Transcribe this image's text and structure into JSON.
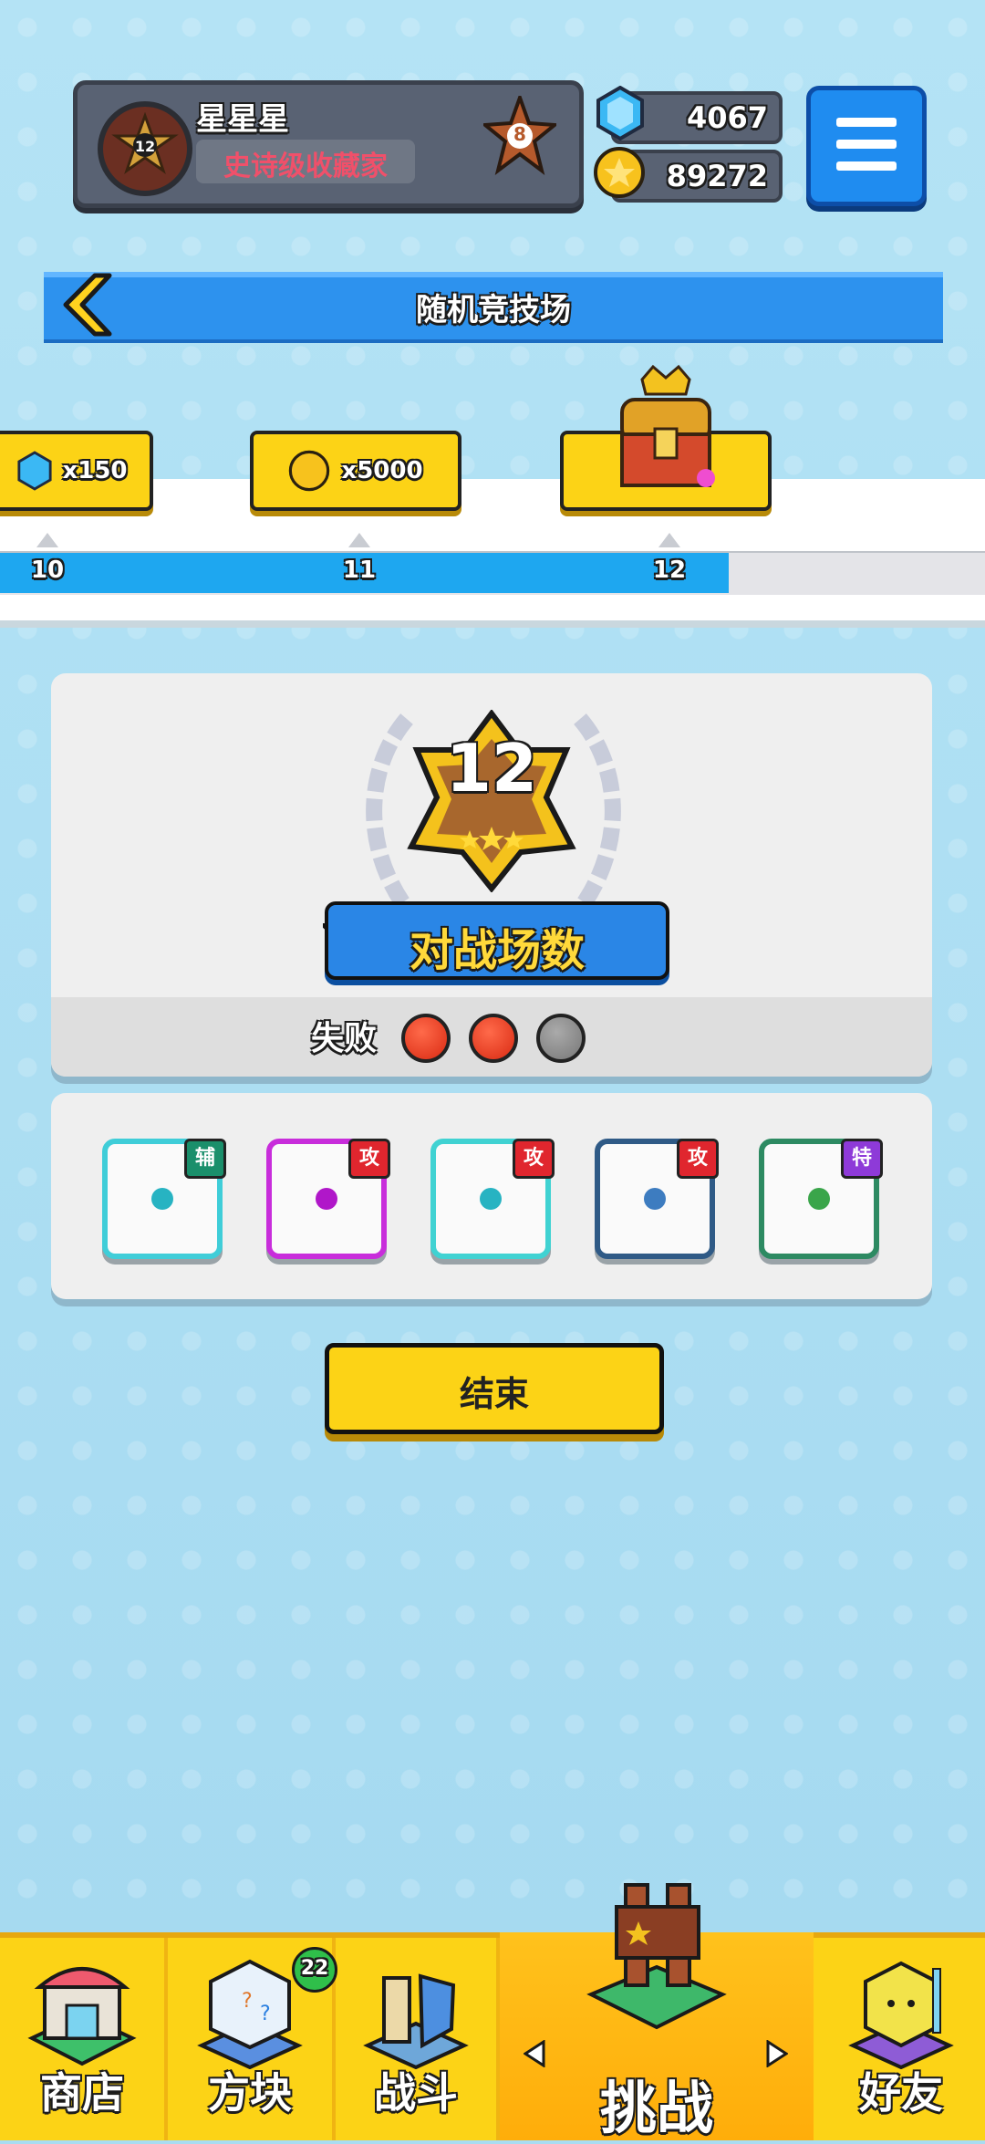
{
  "profile": {
    "name": "星星星",
    "title": "史诗级收藏家",
    "avatar_level": "12",
    "rank": "8"
  },
  "currency": {
    "gems": "4067",
    "coins": "89272"
  },
  "arena": {
    "title": "随机竞技场"
  },
  "rewards": [
    {
      "label": "x150",
      "icon": "gem-icon",
      "tick": "10"
    },
    {
      "label": "x5000",
      "icon": "coin-icon",
      "tick": "11"
    },
    {
      "label": "",
      "icon": "treasure-chest-icon",
      "tick": "12"
    }
  ],
  "progress": {
    "current": 12,
    "fill_fraction": 0.74
  },
  "result": {
    "battle_count": "12",
    "battle_label": "对战场数",
    "loss_label": "失败",
    "losses": [
      true,
      true,
      false
    ]
  },
  "dice": [
    {
      "tag": "辅",
      "tag_color": "#1a8f6b",
      "dot_color": "#27b3c2",
      "border": "#3fcdd8",
      "pattern": "plus"
    },
    {
      "tag": "攻",
      "tag_color": "#e0262e",
      "dot_color": "#b017c9",
      "border": "#c82ddb",
      "pattern": "pixel"
    },
    {
      "tag": "攻",
      "tag_color": "#e0262e",
      "dot_color": "#27b3c2",
      "border": "#40d2d2",
      "pattern": "swirl"
    },
    {
      "tag": "攻",
      "tag_color": "#e0262e",
      "dot_color": "#3d7cc0",
      "border": "#2f5a86",
      "pattern": "vortex"
    },
    {
      "tag": "特",
      "tag_color": "#8e3ad8",
      "dot_color": "#3aa54a",
      "border": "#2d8a62",
      "pattern": "star"
    }
  ],
  "end_button": "结束",
  "nav": {
    "shop": "商店",
    "dice": "方块",
    "battle": "战斗",
    "challenge": "挑战",
    "friends": "好友",
    "dice_badge": "22"
  },
  "colors": {
    "background": "#a9dcf1",
    "accent_blue": "#2d92ee",
    "accent_yellow": "#fcd316"
  }
}
